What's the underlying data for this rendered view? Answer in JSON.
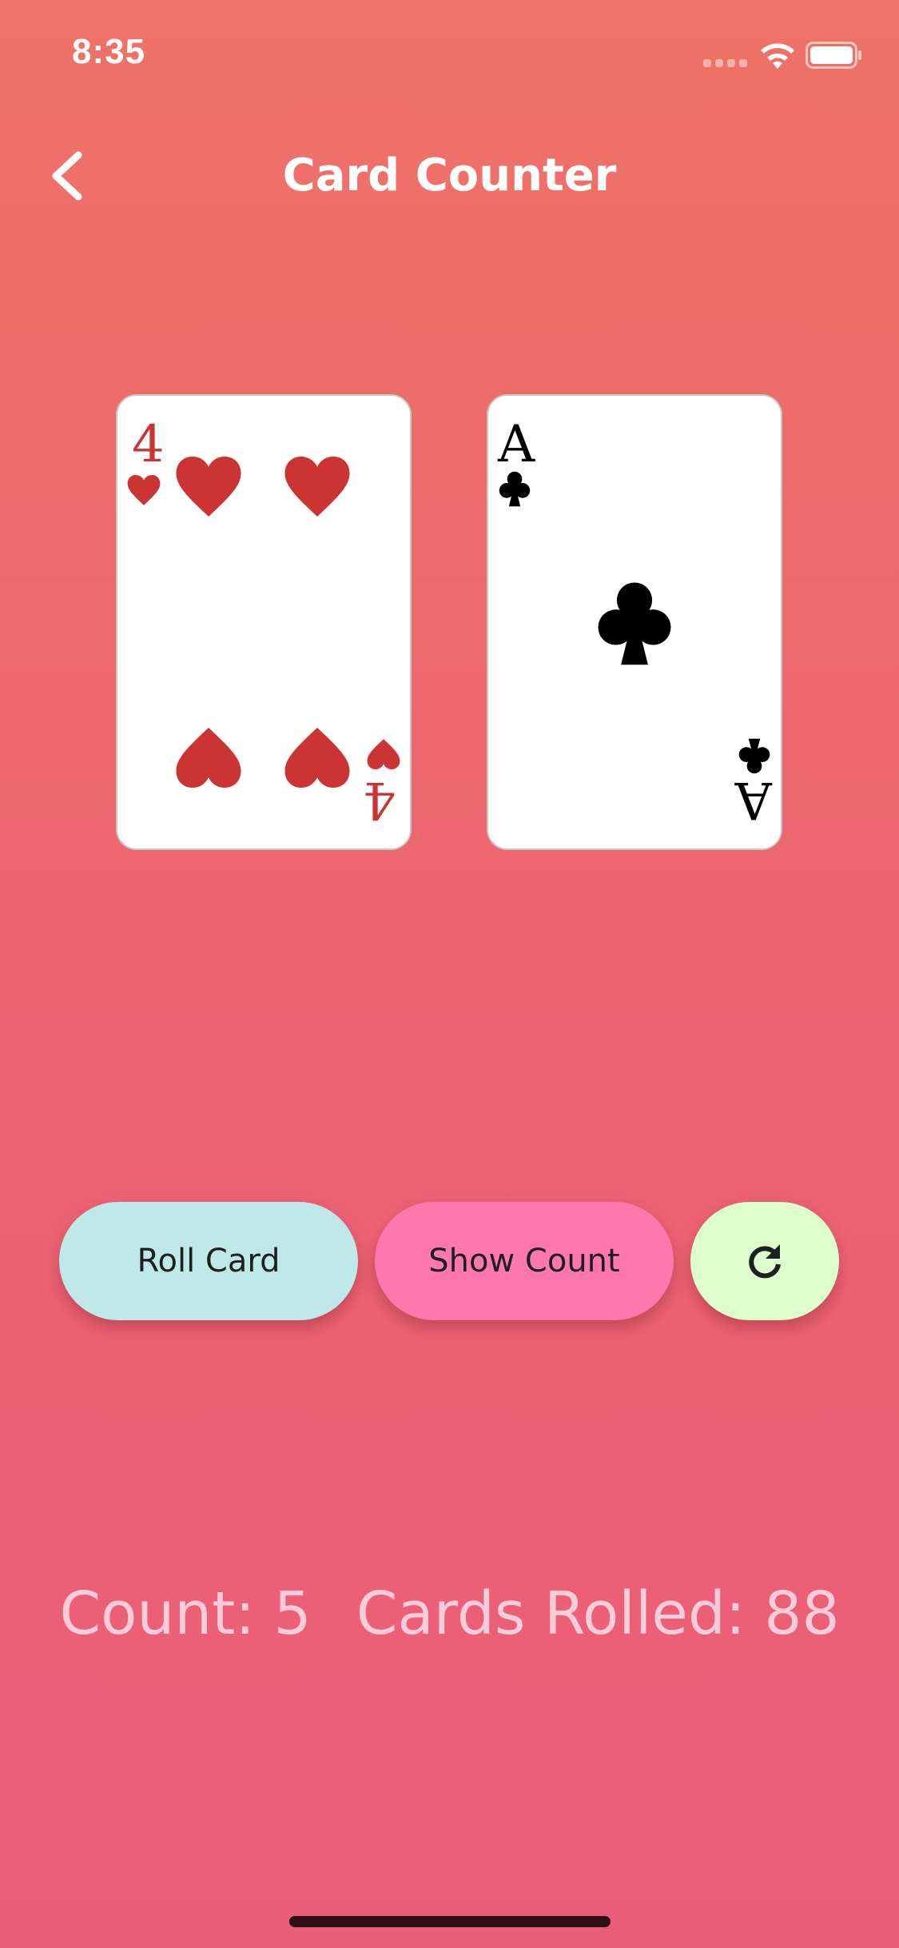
{
  "status_bar": {
    "time": "8:35",
    "icons": [
      "cellular-signal-icon",
      "wifi-icon",
      "battery-icon"
    ]
  },
  "nav": {
    "back_icon": "chevron-left-icon",
    "title": "Card Counter"
  },
  "cards": [
    {
      "rank": "4",
      "suit": "hearts",
      "suit_glyph": "♥",
      "color": "#cc3333"
    },
    {
      "rank": "A",
      "suit": "clubs",
      "suit_glyph": "♣",
      "color": "#000000"
    }
  ],
  "buttons": {
    "roll_label": "Roll Card",
    "show_label": "Show Count",
    "reset_icon": "refresh-icon"
  },
  "stats": {
    "count_text": "Count: 5",
    "cards_rolled_text": "Cards Rolled: 88"
  },
  "colors": {
    "background_top": "#ee7266",
    "background_bottom": "#ea5d79",
    "roll_button": "#bfe9e8",
    "show_button": "#ff78ad",
    "reset_button": "#ddfdcc",
    "heart_red": "#cc3333",
    "stats_text": "#f9cdd7"
  }
}
